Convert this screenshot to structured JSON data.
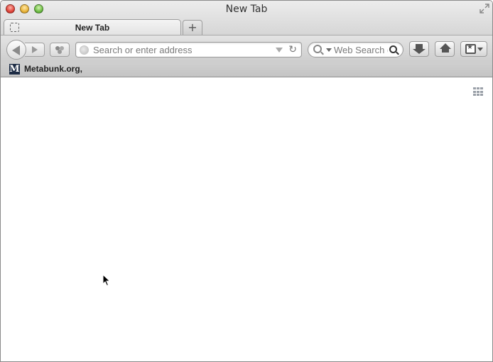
{
  "window": {
    "title": "New Tab"
  },
  "tabs": [
    {
      "title": "New Tab",
      "active": true
    }
  ],
  "toolbar": {
    "new_tab_label": "+",
    "url_placeholder": "Search or enter address",
    "search_placeholder": "Web Search (Google)"
  },
  "bookmarks": [
    {
      "label": "Metabunk.org,",
      "favicon_letter": "M"
    }
  ],
  "icons": {
    "close": "close-icon",
    "minimize": "minimize-icon",
    "zoom": "zoom-icon",
    "fullscreen": "fullscreen-icon",
    "back": "back-arrow-icon",
    "forward": "forward-arrow-icon",
    "identity": "identity-icon",
    "reload": "reload-icon",
    "search": "search-icon",
    "download": "download-icon",
    "home": "home-icon",
    "bookmarks_menu": "bookmarks-star-icon",
    "grid": "grid-icon"
  },
  "colors": {
    "close": "#e0443a",
    "minimize": "#e9b53b",
    "zoom": "#6fbe45",
    "bookmark_favicon_bg": "#1d2c45"
  }
}
